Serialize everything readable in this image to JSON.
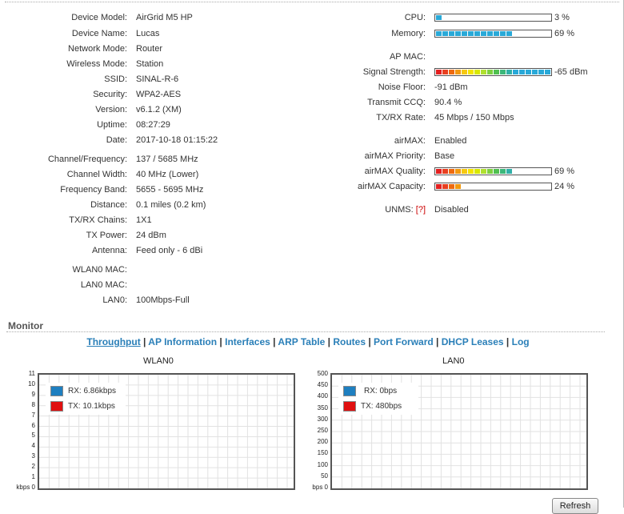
{
  "left_info": [
    {
      "label": "Device Model:",
      "value": "AirGrid M5 HP"
    },
    {
      "label": "Device Name:",
      "value": "Lucas"
    },
    {
      "label": "Network Mode:",
      "value": "Router"
    },
    {
      "label": "Wireless Mode:",
      "value": "Station"
    },
    {
      "label": "SSID:",
      "value": "SINAL-R-6"
    },
    {
      "label": "Security:",
      "value": "WPA2-AES"
    },
    {
      "label": "Version:",
      "value": "v6.1.2 (XM)"
    },
    {
      "label": "Uptime:",
      "value": "08:27:29"
    },
    {
      "label": "Date:",
      "value": "2017-10-18 01:15:22"
    },
    {
      "label": "Channel/Frequency:",
      "value": "137 / 5685 MHz"
    },
    {
      "label": "Channel Width:",
      "value": "40 MHz (Lower)"
    },
    {
      "label": "Frequency Band:",
      "value": "5655 - 5695 MHz"
    },
    {
      "label": "Distance:",
      "value": "0.1 miles (0.2 km)"
    },
    {
      "label": "TX/RX Chains:",
      "value": "1X1"
    },
    {
      "label": "TX Power:",
      "value": "24 dBm"
    },
    {
      "label": "Antenna:",
      "value": "Feed only - 6 dBi"
    },
    {
      "label": "WLAN0 MAC:",
      "value": ""
    },
    {
      "label": "LAN0 MAC:",
      "value": ""
    },
    {
      "label": "LAN0:",
      "value": "100Mbps-Full"
    }
  ],
  "right_info": {
    "cpu": {
      "label": "CPU:",
      "value": "3 %",
      "level": 0.03
    },
    "memory": {
      "label": "Memory:",
      "value": "69 %",
      "level": 0.69
    },
    "ap_mac": {
      "label": "AP MAC:",
      "value": ""
    },
    "signal": {
      "label": "Signal Strength:",
      "value": "-65 dBm",
      "level": 1.0
    },
    "noise": {
      "label": "Noise Floor:",
      "value": "-91 dBm"
    },
    "ccq": {
      "label": "Transmit CCQ:",
      "value": "90.4 %"
    },
    "txrx": {
      "label": "TX/RX Rate:",
      "value": "45 Mbps / 150 Mbps"
    },
    "airmax": {
      "label": "airMAX:",
      "value": "Enabled"
    },
    "airmax_priority": {
      "label": "airMAX Priority:",
      "value": "Base"
    },
    "airmax_quality": {
      "label": "airMAX Quality:",
      "value": "69 %",
      "level": 0.69
    },
    "airmax_capacity": {
      "label": "airMAX Capacity:",
      "value": "24 %",
      "level": 0.24
    },
    "unms": {
      "label": "UNMS:",
      "help": "[?]",
      "value": "Disabled"
    }
  },
  "monitor": {
    "title": "Monitor",
    "tabs": [
      "Throughput",
      "AP Information",
      "Interfaces",
      "ARP Table",
      "Routes",
      "Port Forward",
      "DHCP Leases",
      "Log"
    ],
    "active_tab": "Throughput"
  },
  "colors": {
    "rx": "#1e7fc0",
    "tx": "#e01010",
    "link": "#2a7fb8",
    "bar_blue": "#29a9d8"
  },
  "chart_data": [
    {
      "type": "line",
      "title": "WLAN0",
      "ylabel": "kbps",
      "ylim": [
        0,
        11
      ],
      "yticks": [
        "11",
        "10",
        "9",
        "8",
        "7",
        "6",
        "5",
        "4",
        "3",
        "2",
        "1",
        "kbps 0"
      ],
      "series": [
        {
          "name": "RX: 6.86kbps",
          "values": []
        },
        {
          "name": "TX: 10.1kbps",
          "values": []
        }
      ]
    },
    {
      "type": "line",
      "title": "LAN0",
      "ylabel": "bps",
      "ylim": [
        0,
        500
      ],
      "yticks": [
        "500",
        "450",
        "400",
        "350",
        "300",
        "250",
        "200",
        "150",
        "100",
        "50",
        "bps 0"
      ],
      "series": [
        {
          "name": "RX: 0bps",
          "values": []
        },
        {
          "name": "TX: 480bps",
          "values": []
        }
      ]
    }
  ],
  "refresh_label": "Refresh"
}
